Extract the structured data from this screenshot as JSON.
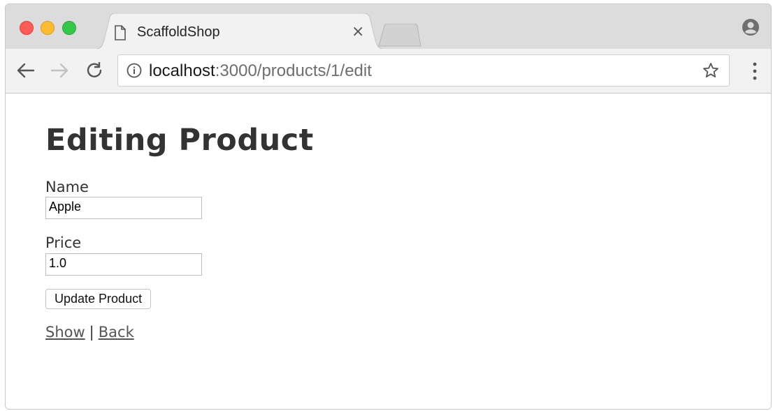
{
  "browser": {
    "tab_title": "ScaffoldShop",
    "tab_close": "×",
    "url_host": "localhost",
    "url_path": ":3000/products/1/edit"
  },
  "page": {
    "title": "Editing Product",
    "name_label": "Name",
    "name_value": "Apple",
    "price_label": "Price",
    "price_value": "1.0",
    "submit_label": "Update Product",
    "show_link": "Show",
    "separator": "|",
    "back_link": "Back"
  },
  "icons": {
    "tab": "document-icon",
    "back": "back-arrow-icon",
    "forward": "forward-arrow-icon",
    "reload": "reload-icon",
    "info": "info-icon",
    "bookmark": "star-icon",
    "profile": "profile-icon",
    "menu": "menu-dots-icon"
  }
}
